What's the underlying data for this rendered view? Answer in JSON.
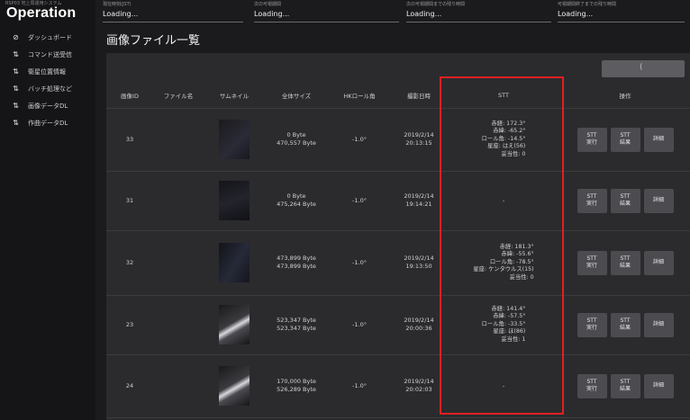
{
  "app": {
    "subtitle": "RSP03 地上局運用システム",
    "title": "Operation"
  },
  "sidebar": {
    "items": [
      {
        "icon": "dashboard-icon",
        "glyph": "⊘",
        "label": "ダッシュボード"
      },
      {
        "icon": "transfer-icon",
        "glyph": "⇅",
        "label": "コマンド送受信"
      },
      {
        "icon": "transfer-icon",
        "glyph": "⇅",
        "label": "衛星位置情報"
      },
      {
        "icon": "transfer-icon",
        "glyph": "⇅",
        "label": "バッチ処理など"
      },
      {
        "icon": "transfer-icon",
        "glyph": "⇅",
        "label": "画像データDL"
      },
      {
        "icon": "transfer-icon",
        "glyph": "⇅",
        "label": "作曲データDL"
      }
    ]
  },
  "header": {
    "cells": [
      {
        "label": "現在時刻(JST)",
        "value": "Loading..."
      },
      {
        "label": "次の可視期間",
        "value": "Loading..."
      },
      {
        "label": "次の可視期間までの残り時間",
        "value": "Loading..."
      },
      {
        "label": "可視期間終了までの残り時間",
        "value": "Loading..."
      }
    ]
  },
  "page": {
    "title": "画像ファイル一覧",
    "spinner_glyph": "(",
    "columns": [
      "画像ID",
      "ファイル名",
      "サムネイル",
      "全体サイズ",
      "HKロール角",
      "撮影日時",
      "STT",
      "操作"
    ]
  },
  "rows": [
    {
      "id": "33",
      "filename": "",
      "size1": "0 Byte",
      "size2": "470,557 Byte",
      "roll": "-1.0°",
      "date": "2019/2/14",
      "time": "20:13:15",
      "stt": [
        "赤経: 172.3°",
        "赤緯: -65.2°",
        "ロール角: -14.5°",
        "星座: はえ(56)",
        "妥当性: 0"
      ],
      "btn_stt_run": [
        "STT",
        "実行"
      ],
      "btn_stt_result": [
        "STT",
        "結果"
      ],
      "btn_detail": "詳細"
    },
    {
      "id": "31",
      "filename": "",
      "size1": "0 Byte",
      "size2": "475,264 Byte",
      "roll": "-1.0°",
      "date": "2019/2/14",
      "time": "19:14:21",
      "stt": [
        "-"
      ],
      "btn_stt_run": [
        "STT",
        "実行"
      ],
      "btn_stt_result": [
        "STT",
        "結果"
      ],
      "btn_detail": "詳細"
    },
    {
      "id": "32",
      "filename": "",
      "size1": "473,899 Byte",
      "size2": "473,899 Byte",
      "roll": "-1.0°",
      "date": "2019/2/14",
      "time": "19:13:50",
      "stt": [
        "赤経: 181.3°",
        "赤緯: -55.6°",
        "ロール角: -78.5°",
        "星座: ケンタウルス(15)",
        "妥当性: 0"
      ],
      "btn_stt_run": [
        "STT",
        "実行"
      ],
      "btn_stt_result": [
        "STT",
        "結果"
      ],
      "btn_detail": "詳細"
    },
    {
      "id": "23",
      "filename": "",
      "size1": "523,347 Byte",
      "size2": "523,347 Byte",
      "roll": "-1.0°",
      "date": "2019/2/14",
      "time": "20:00:36",
      "stt": [
        "赤経: 141.4°",
        "赤緯: -57.5°",
        "ロール角: -33.5°",
        "星座: ほ(86)",
        "妥当性: 1"
      ],
      "btn_stt_run": [
        "STT",
        "実行"
      ],
      "btn_stt_result": [
        "STT",
        "結果"
      ],
      "btn_detail": "詳細"
    },
    {
      "id": "24",
      "filename": "",
      "size1": "170,000 Byte",
      "size2": "526,289 Byte",
      "roll": "-1.0°",
      "date": "2019/2/14",
      "time": "20:02:03",
      "stt": [
        "-"
      ],
      "btn_stt_run": [
        "STT",
        "実行"
      ],
      "btn_stt_result": [
        "STT",
        "結果"
      ],
      "btn_detail": "詳細"
    }
  ],
  "colors": {
    "highlight": "#e02020",
    "panel": "#2b2b2e",
    "button": "#4c4c50"
  }
}
